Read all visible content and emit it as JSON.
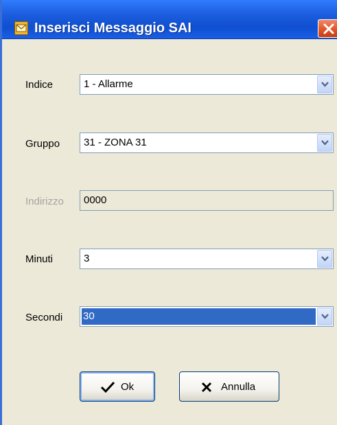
{
  "window": {
    "title": "Inserisci Messaggio SAI",
    "icon": "message-envelope-icon",
    "close_icon": "close-icon"
  },
  "form": {
    "indice": {
      "label": "Indice",
      "value": "1 - Allarme"
    },
    "gruppo": {
      "label": "Gruppo",
      "value": "31 - ZONA 31"
    },
    "indirizzo": {
      "label": "Indirizzo",
      "value": "0000",
      "disabled": true
    },
    "minuti": {
      "label": "Minuti",
      "value": "3"
    },
    "secondi": {
      "label": "Secondi",
      "value": "30",
      "selected": true
    }
  },
  "buttons": {
    "ok_label": "Ok",
    "cancel_label": "Annulla"
  },
  "colors": {
    "titlebar": "#1d5fe0",
    "window_bg": "#ece9d8",
    "selection": "#316ac5",
    "close": "#e25a2c"
  }
}
